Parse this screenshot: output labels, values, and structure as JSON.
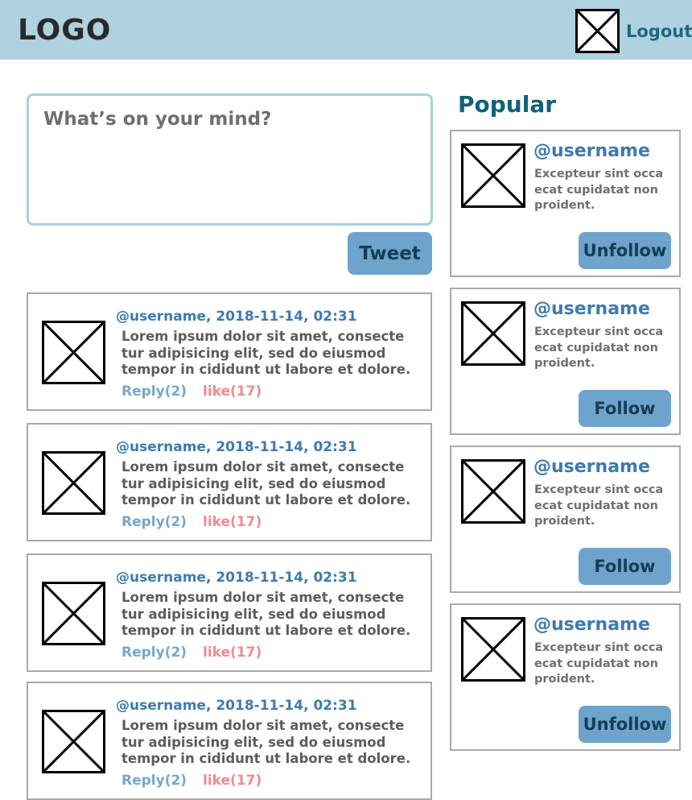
{
  "header": {
    "logo": "LOGO",
    "avatar_icon": "image-placeholder-icon",
    "logout_label": "Logout"
  },
  "compose": {
    "placeholder": "What’s on your mind?",
    "value": "",
    "tweet_label": "Tweet"
  },
  "posts": [
    {
      "meta": "@username, 2018-11-14, 02:31",
      "text": "Lorem ipsum dolor sit amet, consecte tur adipisicing elit, sed do eiusmod tempor in cididunt ut labore et dolore.",
      "reply_label": "Reply(2)",
      "like_label": "like(17)"
    },
    {
      "meta": "@username, 2018-11-14, 02:31",
      "text": "Lorem ipsum dolor sit amet, consecte tur adipisicing elit, sed do eiusmod tempor in cididunt ut labore et dolore.",
      "reply_label": "Reply(2)",
      "like_label": "like(17)"
    },
    {
      "meta": "@username, 2018-11-14, 02:31",
      "text": "Lorem ipsum dolor sit amet, consecte tur adipisicing elit, sed do eiusmod tempor in cididunt ut labore et dolore.",
      "reply_label": "Reply(2)",
      "like_label": "like(17)"
    },
    {
      "meta": "@username, 2018-11-14, 02:31",
      "text": "Lorem ipsum dolor sit amet, consecte tur adipisicing elit, sed do eiusmod tempor in cididunt ut labore et dolore.",
      "reply_label": "Reply(2)",
      "like_label": "like(17)"
    }
  ],
  "popular": {
    "title": "Popular",
    "users": [
      {
        "username": "@username",
        "description": "Excepteur sint occa ecat cupidatat non proident.",
        "button_label": "Unfollow"
      },
      {
        "username": "@username",
        "description": "Excepteur sint occa ecat cupidatat non proident.",
        "button_label": "Follow"
      },
      {
        "username": "@username",
        "description": "Excepteur sint occa ecat cupidatat non proident.",
        "button_label": "Follow"
      },
      {
        "username": "@username",
        "description": "Excepteur sint occa ecat cupidatat non proident.",
        "button_label": "Unfollow"
      }
    ]
  },
  "colors": {
    "header_bg": "#b0d1df",
    "accent_blue": "#6ea3cb",
    "link_blue": "#3c7ab2",
    "like_red": "#f08a8e",
    "title_teal": "#116078"
  }
}
